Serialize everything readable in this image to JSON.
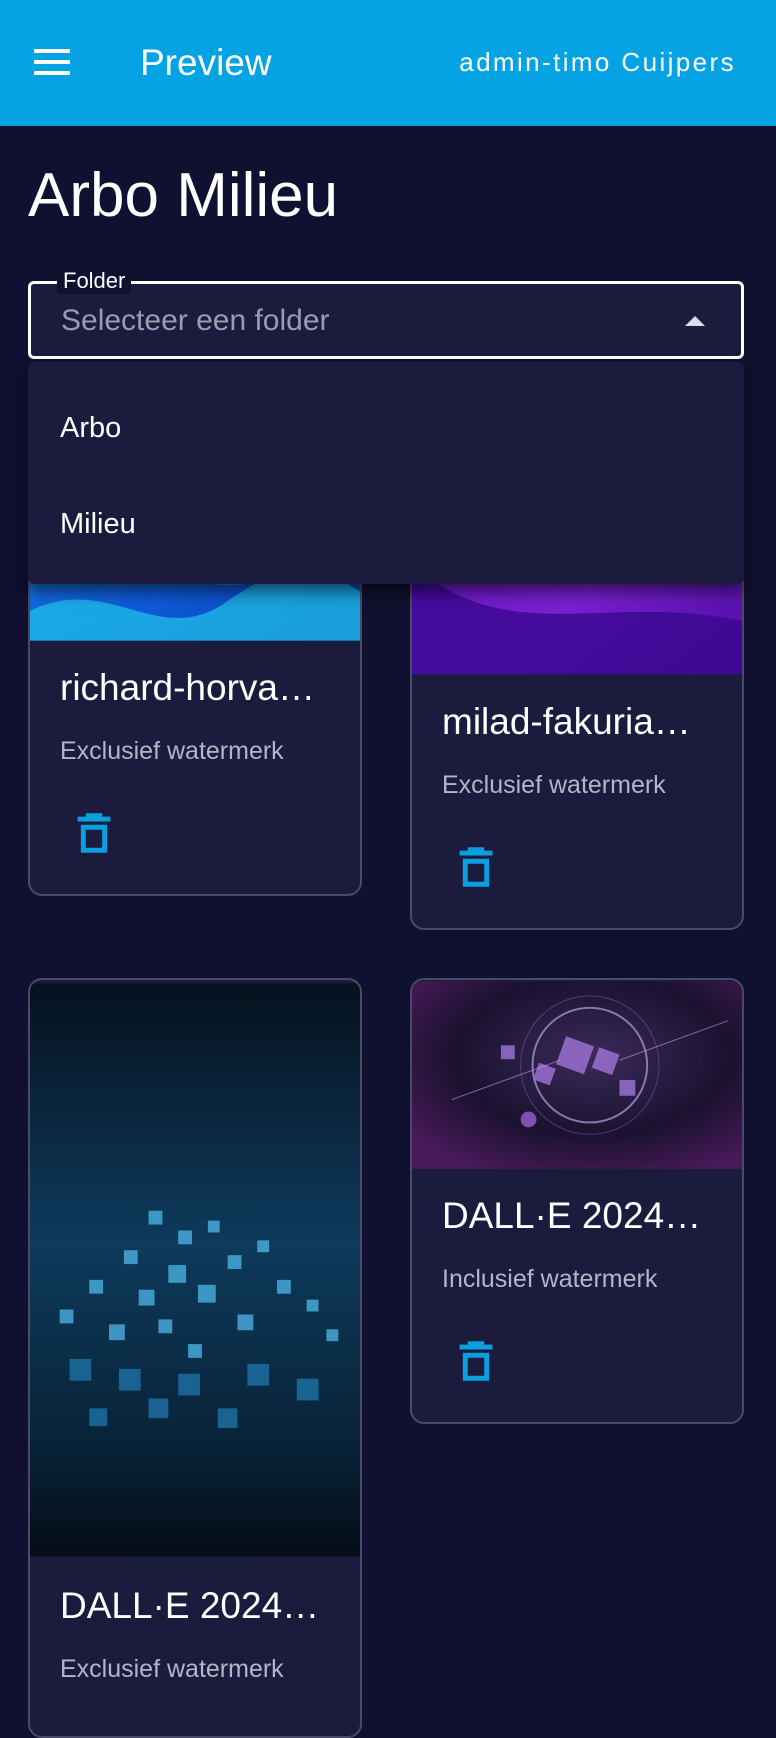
{
  "appbar": {
    "title": "Preview",
    "user": "admin-timo Cuijpers"
  },
  "page": {
    "title": "Arbo Milieu"
  },
  "folder_select": {
    "label": "Folder",
    "placeholder": "Selecteer een folder",
    "options": [
      "Arbo",
      "Milieu"
    ]
  },
  "cards": [
    {
      "title": "richard-horva…",
      "subtitle": "Exclusief watermerk"
    },
    {
      "title": "milad-fakuria…",
      "subtitle": "Exclusief watermerk"
    },
    {
      "title": "DALL·E 2024…",
      "subtitle": "Exclusief watermerk"
    },
    {
      "title": "DALL·E 2024…",
      "subtitle": "Inclusief watermerk"
    }
  ],
  "colors": {
    "appbar": "#05a3e3",
    "background": "#101030",
    "surface": "#1b1b3e",
    "accent": "#0aa0e0"
  }
}
